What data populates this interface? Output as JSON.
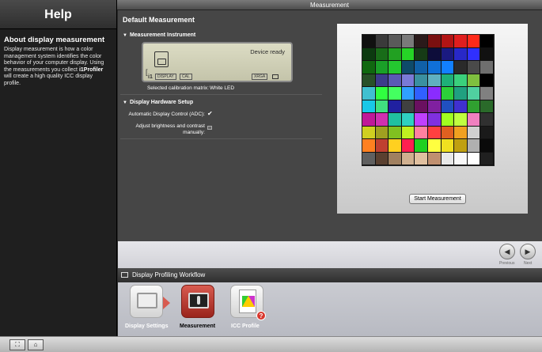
{
  "window": {
    "title": "Measurement"
  },
  "help": {
    "title": "Help",
    "heading": "About display measurement",
    "body_1": "Display measurement is how a color management system identifies the color behavior of your computer display. Using the measurements you collect ",
    "body_brand": "i1Profiler",
    "body_2": " will create a high quality ICC display profile."
  },
  "main": {
    "title": "Default Measurement",
    "instrument": {
      "heading": "Measurement Instrument",
      "status": "Device ready",
      "brand": "i1",
      "tags": [
        "DISPLAY",
        "CAL",
        "XRGA"
      ],
      "calibration_label": "Selected calibration matrix:",
      "calibration_value": "White LED"
    },
    "hardware": {
      "heading": "Display Hardware Setup",
      "adc_label": "Automatic Display Control (ADC):",
      "adc_checked": true,
      "adjust_label_1": "Adjust brightness and contrast",
      "adjust_label_2": "manually:",
      "adjust_checked": false
    },
    "start_button": "Start Measurement"
  },
  "nav": {
    "previous": "Previous",
    "next": "Next"
  },
  "workflow": {
    "title": "Display Profiling Workflow",
    "steps": [
      {
        "label": "Display Settings",
        "state": "done"
      },
      {
        "label": "Measurement",
        "state": "active"
      },
      {
        "label": "ICC Profile",
        "state": "pending"
      }
    ]
  },
  "patch_colors": [
    [
      "#101010",
      "#3a3a3a",
      "#5a5a5a",
      "#7a7a7a",
      "#2a1a1a",
      "#7a1010",
      "#b21414",
      "#e01e1e",
      "#ff2a1a",
      "#000000"
    ],
    [
      "#0c3a10",
      "#186c18",
      "#22a022",
      "#26d426",
      "#163b16",
      "#0d0d3a",
      "#1a1a80",
      "#2828c8",
      "#3030ff",
      "#111111"
    ],
    [
      "#106810",
      "#1aa028",
      "#24c830",
      "#0e4a6a",
      "#1060a8",
      "#1070d8",
      "#1280ff",
      "#2a2a2a",
      "#4a4a4a",
      "#6e6e6e"
    ],
    [
      "#285028",
      "#3c3c8a",
      "#5a5ab4",
      "#7a7ad6",
      "#3a90a0",
      "#60b0c0",
      "#1eb078",
      "#3ad07c",
      "#7fbf3f",
      "#000000"
    ],
    [
      "#40c0d0",
      "#30ff40",
      "#44ff60",
      "#30a0ff",
      "#3060ff",
      "#8a2cff",
      "#2ccf3a",
      "#20a080",
      "#50d0a0",
      "#808080"
    ],
    [
      "#18c8e8",
      "#40e080",
      "#2020a0",
      "#404040",
      "#6a1060",
      "#8020a0",
      "#2050c0",
      "#4030d0",
      "#30a030",
      "#2a6a2a"
    ],
    [
      "#c01898",
      "#d030b0",
      "#20c0a0",
      "#30d0c0",
      "#c040ff",
      "#8030e0",
      "#a0ff20",
      "#c0ff40",
      "#f080c0",
      "#303030"
    ],
    [
      "#d0d020",
      "#a0a020",
      "#80c020",
      "#c0f020",
      "#ff80a0",
      "#ff4040",
      "#e06020",
      "#f0a020",
      "#d0d0d0",
      "#1a1a1a"
    ],
    [
      "#ff8020",
      "#c04030",
      "#ffd020",
      "#ff2050",
      "#20d020",
      "#ffff40",
      "#f0e020",
      "#c0a010",
      "#b0b0b0",
      "#0a0a0a"
    ],
    [
      "#606060",
      "#5a4030",
      "#a08060",
      "#d0b090",
      "#e0c0a0",
      "#c09070",
      "#e8e8e8",
      "#f8f8f8",
      "#ffffff",
      "#202020"
    ]
  ]
}
